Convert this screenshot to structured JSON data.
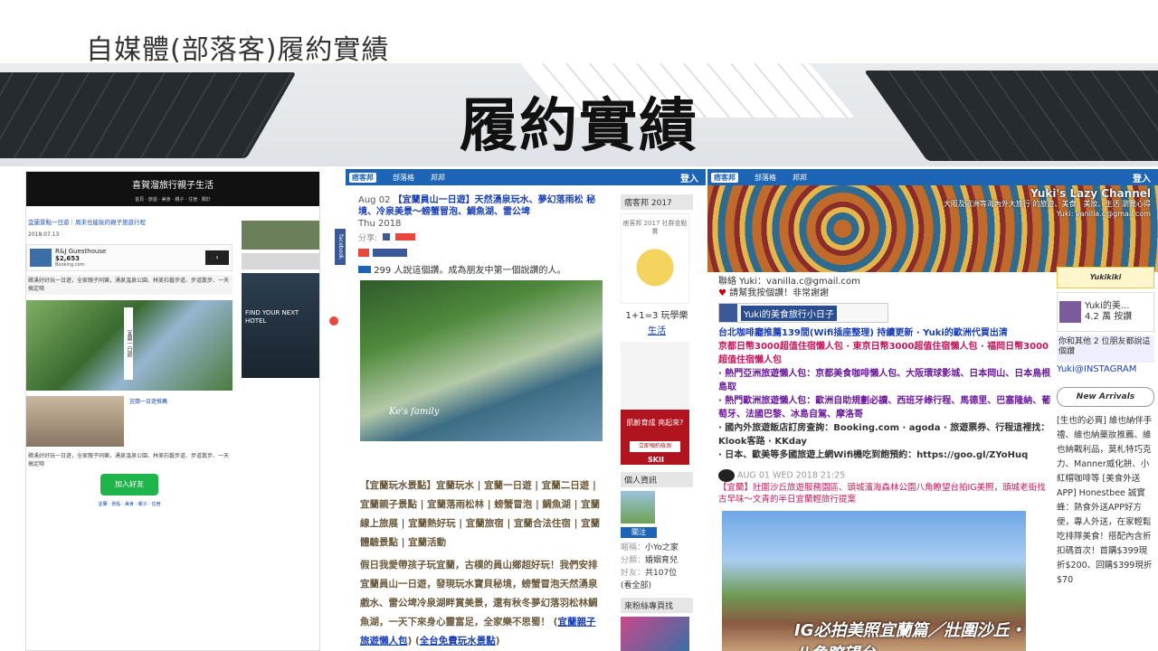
{
  "slide": {
    "title": "自媒體(部落客)履約實績",
    "banner_title": "履約實績"
  },
  "shot1": {
    "blog_title": "喜賀溜旅行親子生活",
    "nav": "首頁  ·  旅遊  ·  美食  ·  親子  ·  住宿  ·  關於",
    "post_title": "宜蘭景點一日遊｜周末也能玩的親子旅遊行程",
    "meta": "2018.07.13",
    "ad_name": "R&J Guesthouse",
    "ad_price": "$2,653",
    "ad_site": "Booking.com",
    "snippet": "礁溪好好玩一日遊，全家親子同樂，湧泉溫泉公園、林美石磐步道、步道散步、一天搞定唷",
    "photo_caption": "宜蘭一日遊",
    "ad2_title": "宜蘭一日遊推薦",
    "fb_tab": "facebook",
    "hotel_ad": "FIND YOUR NEXT HOTEL",
    "line_btn": "加入好友",
    "links": "宜蘭 · 景點 · 美食 · 親子 · 住宿"
  },
  "shot2": {
    "pix_logo": "痞客邦",
    "nav_items": [
      "部落格",
      "邦邦"
    ],
    "login": "登入",
    "date": "Aug 02",
    "post_title": "【宜蘭員山一日遊】天然湧泉玩水、夢幻落雨松 秘境、冷泉美景～螃蟹冒泡、鯛魚湖、雷公埤",
    "year_line": "Thu 2018",
    "share_label": "分享:",
    "says": "299 人說這個讚。成為朋友中第一個說讚的人。",
    "photo_script": "Ke's family",
    "tags": "【宜蘭玩水景點】宜蘭玩水 | 宜蘭一日遊 | 宜蘭二日遊 | 宜蘭親子景點 | 宜蘭落雨松林 | 螃蟹冒泡 | 鯛魚湖 | 宜蘭線上旅展 | 宜蘭熱好玩 | 宜蘭旅宿 | 宜蘭合法住宿 | 宜蘭體驗景點 | 宜蘭活動",
    "body": "假日我愛帶孩子玩宜蘭，古樸的員山鄉超好玩！我們安排宜蘭員山一日遊，發現玩水寶貝秘境，螃蟹冒泡天然湧泉戲水、雷公埤冷泉湖畔賞美景，還有秋冬夢幻落羽松林鯛魚湖，一天下來身心靈富足，全家樂不思蜀！",
    "body_link1": "宜蘭親子旅遊懶人包",
    "body_link2": "全台免費玩水景點",
    "side_head": "痞客邦 2017",
    "badge_text": "痞客邦 2017 社群金點賞",
    "promo1": "1+1=3 玩學樂",
    "promo2": "生活",
    "sk2_line": "肌齡育成 亮起來?",
    "sk2_btn": "立即預約檢測",
    "sk2_logo": "SKII",
    "personal_head": "個人資訊",
    "follow": "關注",
    "info": [
      {
        "k": "暱稱：",
        "v": "小Yo之家"
      },
      {
        "k": "分類：",
        "v": "婚姻育兒"
      },
      {
        "k": "好友：",
        "v": "共107位"
      },
      {
        "k": "",
        "v": "(看全部)"
      }
    ],
    "fans_head": "來粉絲專頁找"
  },
  "shot3": {
    "pix_logo": "痞客邦",
    "nav_items": [
      "部落格",
      "邦邦"
    ],
    "login": "登入",
    "channel": "Yuki's Lazy Channel",
    "channel_sub": "大阪及歐洲等海內外大旅行 的旅遊、美食、美妝、生活 瀏覽心得 Yuki: vanilla.c@gmail.com",
    "contact": "聯絡 Yuki：vanilla.c@gmail.com",
    "thanks": "請幫我按個讚！非常謝謝",
    "fb_page": "Yuki的美食旅行小日子",
    "lines": [
      "台北咖啡廳推薦139間(Wifi插座整理) 持續更新 · Yuki的歐洲代買出清",
      "京都日幣3000超值住宿懶人包 · 東京日幣3000超值住宿懶人包 · 福岡日幣3000超值住宿懶人包",
      "· 熱門亞洲旅遊懶人包：京都美食咖啡懶人包、大阪環球影城、日本岡山、日本鳥根島取",
      "· 熱門歐洲旅遊懶人包：歐洲自助規劃必讀、西班牙綠行程、馬德里、巴塞隆納、葡萄牙、法國巴黎、冰島自駕、摩洛哥",
      "· 國內外旅遊飯店訂房查詢：Booking.com · agoda · 旅遊票券、行程這裡找：Klook客路 · KKday",
      "· 日本、歐美等多國旅遊上網Wifi機吃到飽預約：https://goo.gl/ZYoHuq"
    ],
    "post_date": "AUG 01 WED 2018 21:25",
    "post_title": "【宜蘭】壯圍沙丘旅遊服務園區、頭城濱海森林公園八角瞭望台拍IG美照，頭城老街找古早味～文青的半日宜蘭輕旅行提案",
    "photo_caption": "IG必拍美照宜蘭篇／壯圍沙丘・八角瞭望台",
    "side_head": "Yukikiki",
    "card_title": "Yuki的美...",
    "card_sub": "4.2 萬 按讚",
    "fb_line": "你和其他 2 位朋友都說這個讚",
    "ig": "Yuki@INSTAGRAM",
    "new_arrivals": "New Arrivals",
    "side_text": "[生也的必買] 維也納伴手禮、維也納藥妝推薦、維也納戰利品，莫札特巧克力、Manner威化餅、小紅帽咖啡等 [美食外送APP] Honestbee 誠實蜂：熱食外送APP好方便，專人外送，在家輕鬆吃排隊美食！搭配內含折扣碼首次！首購$399現折$200、回購$399現折$70"
  }
}
